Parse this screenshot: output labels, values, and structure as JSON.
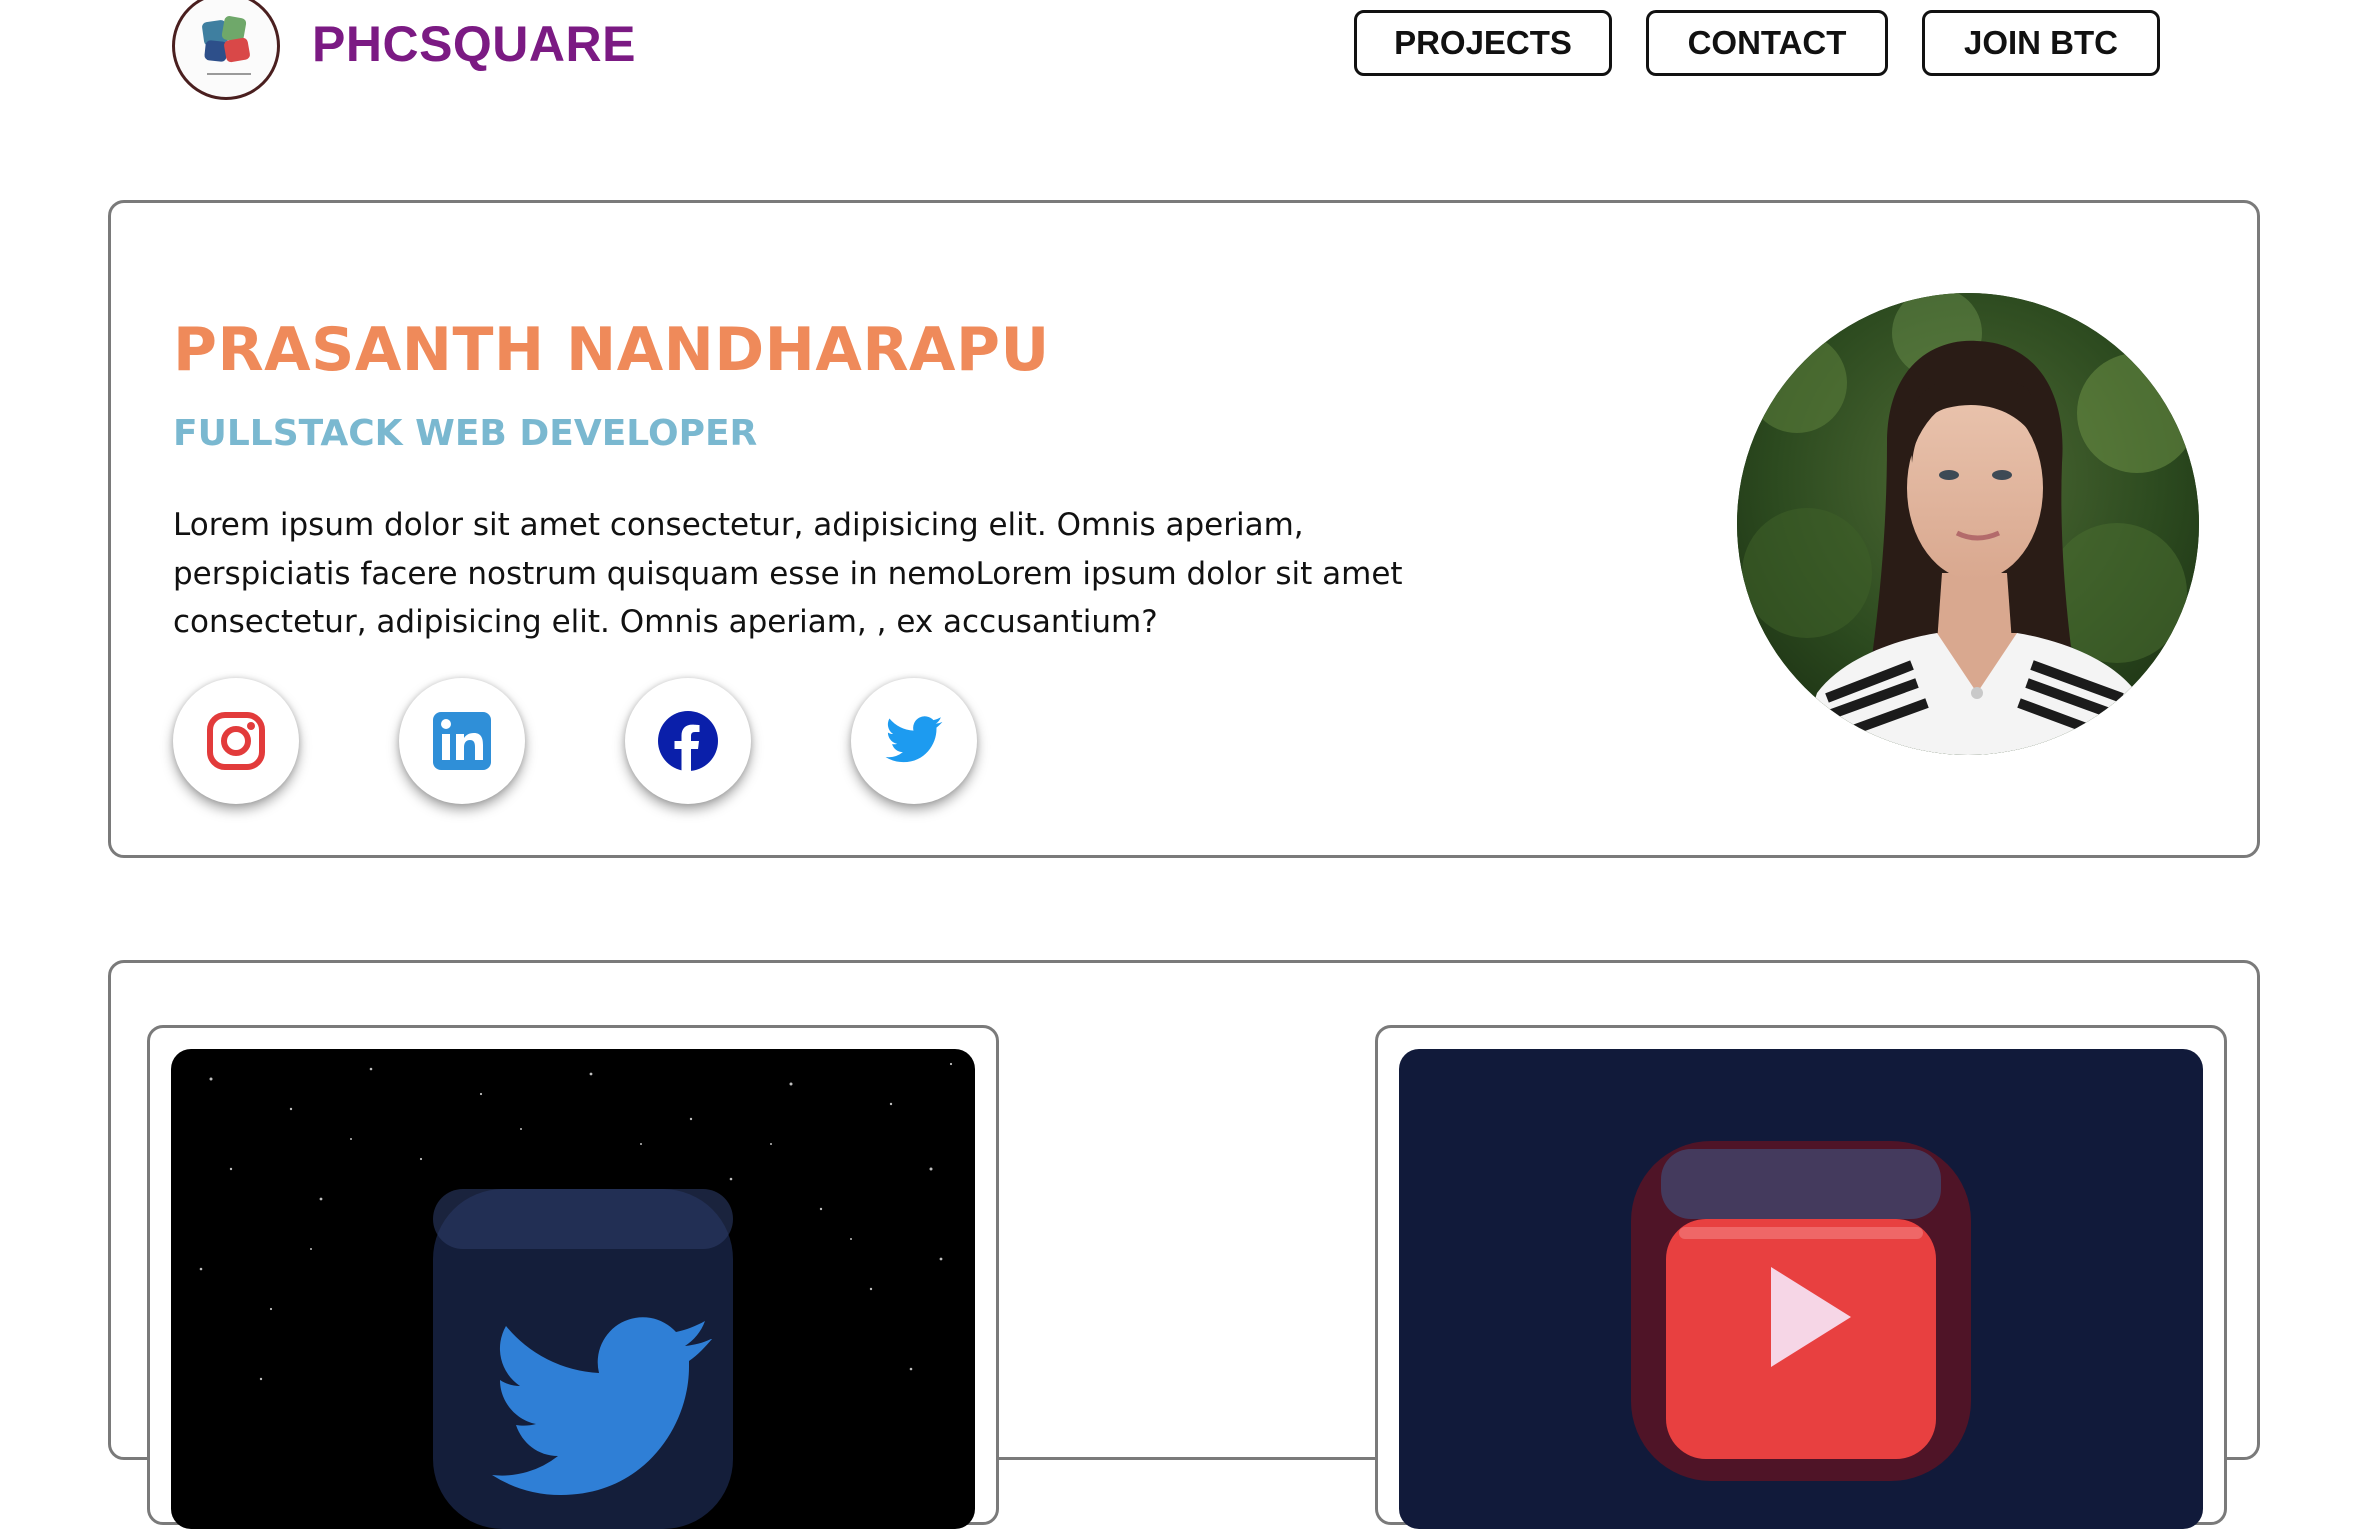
{
  "header": {
    "brand": "PHCSQUARE",
    "logo_icon": "square-logo-icon",
    "nav": [
      {
        "label": "PROJECTS"
      },
      {
        "label": "CONTACT"
      },
      {
        "label": "JOIN BTC"
      }
    ]
  },
  "hero": {
    "name": "PRASANTH NANDHARAPU",
    "role": "FULLSTACK WEB DEVELOPER",
    "description": "Lorem ipsum dolor sit amet consectetur, adipisicing elit. Omnis aperiam, perspiciatis facere nostrum quisquam esse in nemoLorem ipsum dolor sit amet consectetur, adipisicing elit. Omnis aperiam, , ex accusantium?",
    "socials": [
      {
        "icon": "instagram-icon",
        "color": "#e1306c"
      },
      {
        "icon": "linkedin-icon",
        "color": "#2f8fd8"
      },
      {
        "icon": "facebook-icon",
        "color": "#0a1faa"
      },
      {
        "icon": "twitter-icon",
        "color": "#1d9bf0"
      }
    ],
    "avatar_icon": "profile-photo"
  },
  "projects": {
    "cards": [
      {
        "icon": "twitter-app-icon",
        "bg": "#000000"
      },
      {
        "icon": "youtube-app-icon",
        "bg": "#111a3a"
      }
    ]
  },
  "colors": {
    "brand": "#7b1a83",
    "name": "#ef8a5a",
    "role": "#7ab8d0",
    "border": "#7a7a7a"
  }
}
